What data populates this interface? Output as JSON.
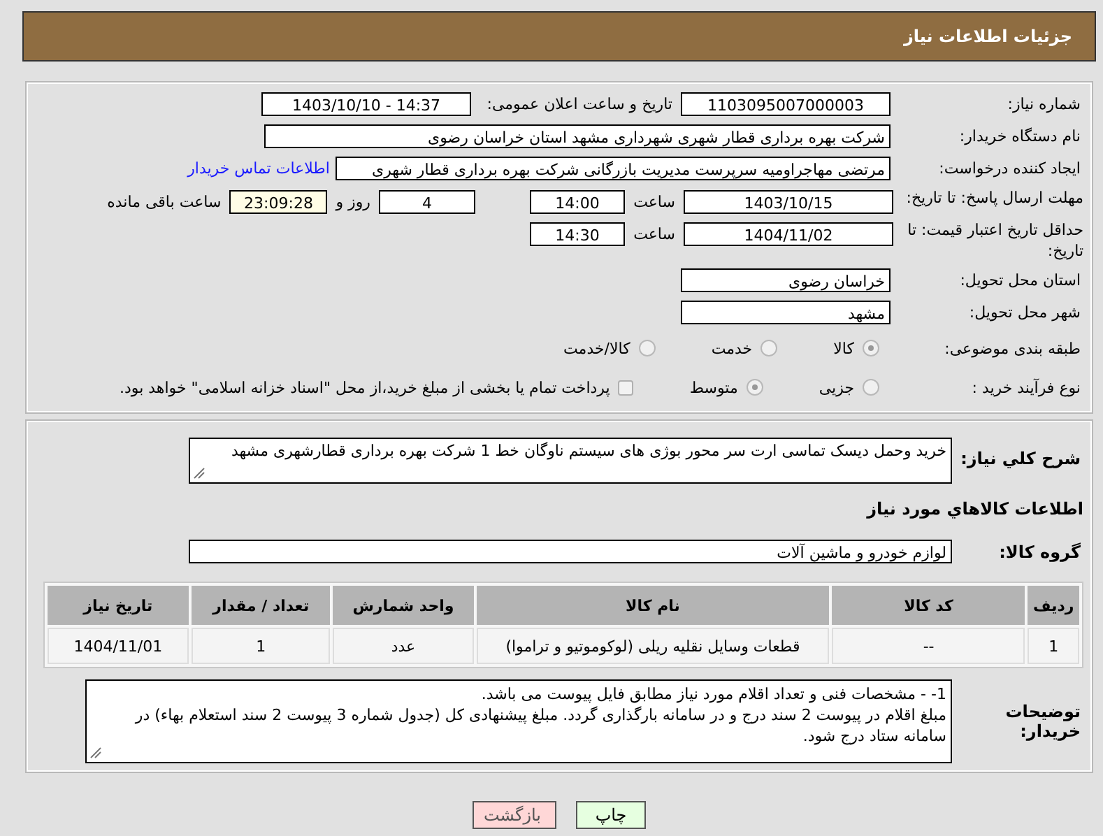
{
  "header": {
    "title": "جزئیات اطلاعات نیاز"
  },
  "need_number": {
    "label": "شماره نیاز:",
    "value": "1103095007000003"
  },
  "announce": {
    "label": "تاریخ و ساعت اعلان عمومی:",
    "value": "1403/10/10 - 14:37"
  },
  "buyer_org": {
    "label": "نام دستگاه خریدار:",
    "value": "شرکت بهره برداری قطار شهری شهرداری مشهد استان خراسان رضوی"
  },
  "requester": {
    "label": "ایجاد کننده درخواست:",
    "value": "مرتضی مهاجراومیه سرپرست مدیریت بازرگانی شرکت بهره برداری قطار شهری",
    "link": "اطلاعات تماس خریدار"
  },
  "deadline": {
    "label": "مهلت ارسال پاسخ: تا تاریخ:",
    "date": "1403/10/15",
    "time_label": "ساعت",
    "time": "14:00",
    "days": "4",
    "days_label": "روز و",
    "remaining": "23:09:28",
    "remaining_label": "ساعت باقی مانده"
  },
  "validity": {
    "label": "حداقل تاریخ اعتبار قیمت: تا تاریخ:",
    "date": "1404/11/02",
    "time_label": "ساعت",
    "time": "14:30"
  },
  "province": {
    "label": "استان محل تحویل:",
    "value": "خراسان رضوی"
  },
  "city": {
    "label": "شهر محل تحویل:",
    "value": "مشهد"
  },
  "category": {
    "label": "طبقه بندی موضوعی:",
    "options": [
      {
        "label": "کالا",
        "selected": true
      },
      {
        "label": "خدمت",
        "selected": false
      },
      {
        "label": "کالا/خدمت",
        "selected": false
      }
    ]
  },
  "process": {
    "label": "نوع فرآیند خرید :",
    "options": [
      {
        "label": "جزیی",
        "selected": false
      },
      {
        "label": "متوسط",
        "selected": true
      }
    ],
    "payment": {
      "checked": false,
      "text": "پرداخت تمام یا بخشی از مبلغ خرید،از محل \"اسناد خزانه اسلامی\" خواهد بود."
    }
  },
  "description": {
    "label": "شرح کلي نياز:",
    "value": "خرید وحمل دیسک تماسی ارت سر محور بوژی های سیستم ناوگان خط 1 شرکت بهره برداری قطارشهری مشهد"
  },
  "goods_heading": "اطلاعات کالاهاي مورد نياز",
  "goods_group": {
    "label": "گروه کالا:",
    "value": "لوازم خودرو و ماشین آلات"
  },
  "table": {
    "columns": [
      "ردیف",
      "کد کالا",
      "نام کالا",
      "واحد شمارش",
      "تعداد / مقدار",
      "تاریخ نیاز"
    ],
    "rows": [
      [
        "1",
        "--",
        "قطعات وسایل نقلیه ریلی (لوکوموتیو و تراموا)",
        "عدد",
        "1",
        "1404/11/01"
      ]
    ]
  },
  "buyer_notes": {
    "label": "توضیحات خریدار:",
    "lines": [
      "1- - مشخصات فنی و تعداد اقلام مورد نیاز مطابق فایل پیوست می باشد.",
      "مبلغ اقلام در پیوست 2 سند درج و در سامانه بارگذاری گردد. مبلغ پیشنهادی کل (جدول شماره 3 پیوست 2 سند استعلام بهاء) در سامانه ستاد درج شود."
    ]
  },
  "buttons": [
    {
      "label": "چاپ",
      "kind": "print"
    },
    {
      "label": "بازگشت",
      "kind": "back"
    }
  ]
}
